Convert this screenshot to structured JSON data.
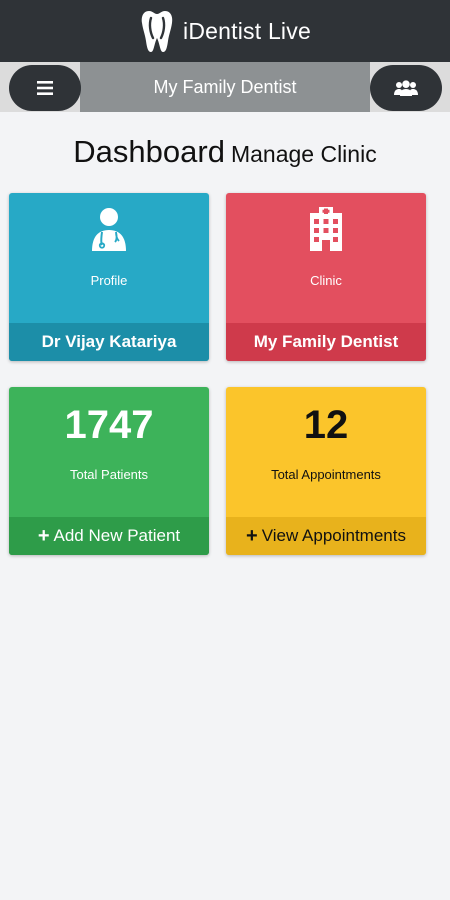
{
  "app": {
    "title_main": "iDentist",
    "title_suffix": "Live"
  },
  "header": {
    "title": "My Family Dentist"
  },
  "heading": {
    "main": "Dashboard",
    "sub": "Manage Clinic"
  },
  "cards": {
    "profile": {
      "caption": "Profile",
      "footer": "Dr Vijay Katariya",
      "icon": "doctor-icon"
    },
    "clinic": {
      "caption": "Clinic",
      "footer": "My Family Dentist",
      "icon": "hospital-icon"
    },
    "patients": {
      "number": "1747",
      "caption": "Total Patients",
      "footer": "Add New Patient",
      "icon": "plus-icon"
    },
    "appointments": {
      "number": "12",
      "caption": "Total Appointments",
      "footer": "View Appointments",
      "icon": "plus-icon"
    }
  },
  "colors": {
    "topbar": "#2f3337",
    "profile": "#27a9c6",
    "clinic": "#e34f5f",
    "patients": "#3db35a",
    "appointments": "#fbc52b"
  }
}
